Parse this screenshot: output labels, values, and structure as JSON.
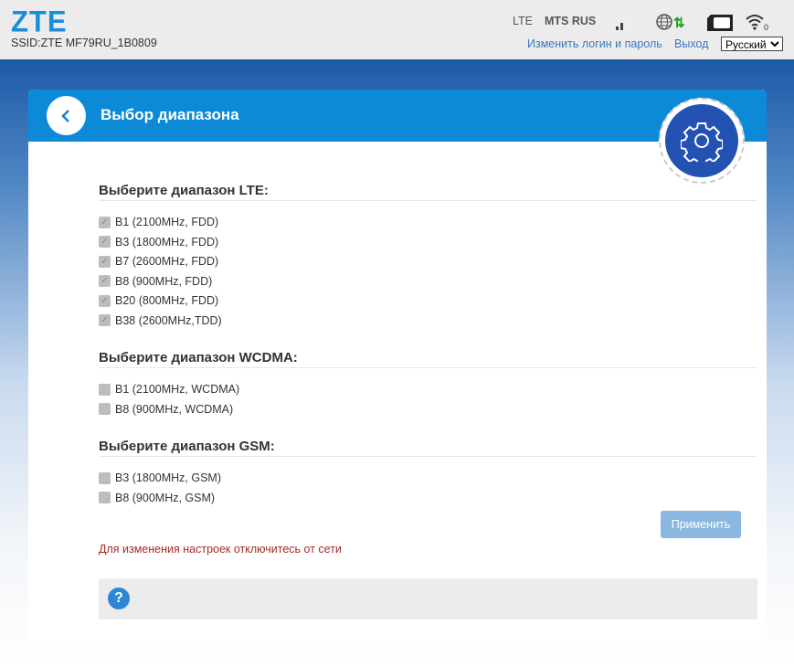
{
  "header": {
    "logo": "ZTE",
    "ssid": "SSID:ZTE MF79RU_1B0809",
    "network_type": "LTE",
    "operator": "MTS RUS",
    "wifi_clients": "0",
    "change_login": "Изменить логин и пароль",
    "logout": "Выход",
    "language": "Русский"
  },
  "page": {
    "title": "Выбор диапазона",
    "apply": "Применить",
    "warning": "Для изменения настроек отключитесь от сети",
    "help": "?"
  },
  "lte": {
    "heading": "Выберите диапазон LTE:",
    "bands": [
      "B1 (2100MHz, FDD)",
      "B3 (1800MHz, FDD)",
      "B7 (2600MHz, FDD)",
      "B8 (900MHz, FDD)",
      "B20 (800MHz, FDD)",
      "B38 (2600MHz,TDD)"
    ]
  },
  "wcdma": {
    "heading": "Выберите диапазон WCDMA:",
    "bands": [
      "B1 (2100MHz, WCDMA)",
      "B8 (900MHz, WCDMA)"
    ]
  },
  "gsm": {
    "heading": "Выберите диапазон GSM:",
    "bands": [
      "B3 (1800MHz, GSM)",
      "B8 (900MHz, GSM)"
    ]
  }
}
